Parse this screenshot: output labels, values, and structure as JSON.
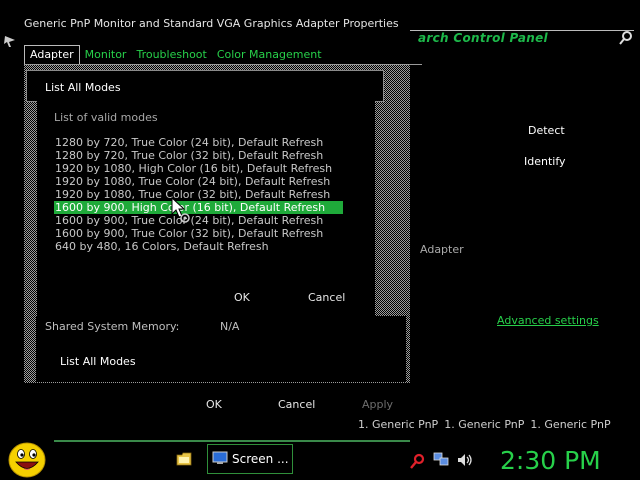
{
  "props_dialog": {
    "title": "Generic PnP Monitor and Standard VGA Graphics Adapter Properties",
    "tabs": [
      {
        "label": "Adapter",
        "active": true
      },
      {
        "label": "Monitor",
        "active": false
      },
      {
        "label": "Troubleshoot",
        "active": false
      },
      {
        "label": "Color Management",
        "active": false
      }
    ],
    "shared_memory_label": "Shared System Memory:",
    "shared_memory_value": "N/A",
    "list_all_modes_button": "List All Modes",
    "ok_label": "OK",
    "cancel_label": "Cancel",
    "apply_label": "Apply"
  },
  "list_modes_dialog": {
    "title": "List All Modes",
    "group_label": "List of valid modes",
    "modes": [
      "1280 by 720, True Color (24 bit), Default Refresh",
      "1280 by 720, True Color (32 bit), Default Refresh",
      "1920 by 1080, High Color (16 bit), Default Refresh",
      "1920 by 1080, True Color (24 bit), Default Refresh",
      "1920 by 1080, True Color (32 bit), Default Refresh",
      "1600 by 900, High Color (16 bit), Default Refresh",
      "1600 by 900, True Color (24 bit), Default Refresh",
      "1600 by 900, True Color (32 bit), Default Refresh",
      "640 by 480, 16 Colors, Default Refresh"
    ],
    "selected_index": 5,
    "ok_label": "OK",
    "cancel_label": "Cancel"
  },
  "control_panel": {
    "title_fragment": "arch Control Panel",
    "detect_label": "Detect",
    "identify_label": "Identify",
    "adapter_label": "Adapter",
    "advanced_link": "Advanced settings",
    "monitor_labels": [
      "1. Generic PnP",
      "1. Generic PnP",
      "1. Generic PnP"
    ]
  },
  "taskbar": {
    "task_label": "Screen ...",
    "clock": "2:30 PM"
  },
  "colors": {
    "accent_green": "#27d04a",
    "selection_green": "#1faa3a",
    "background": "#000000"
  },
  "icons": {
    "start": "smiley-face-icon",
    "folder": "folder-icon",
    "task": "screen-icon",
    "tray_search": "search-icon",
    "tray_network": "network-icon",
    "tray_volume": "speaker-icon"
  }
}
